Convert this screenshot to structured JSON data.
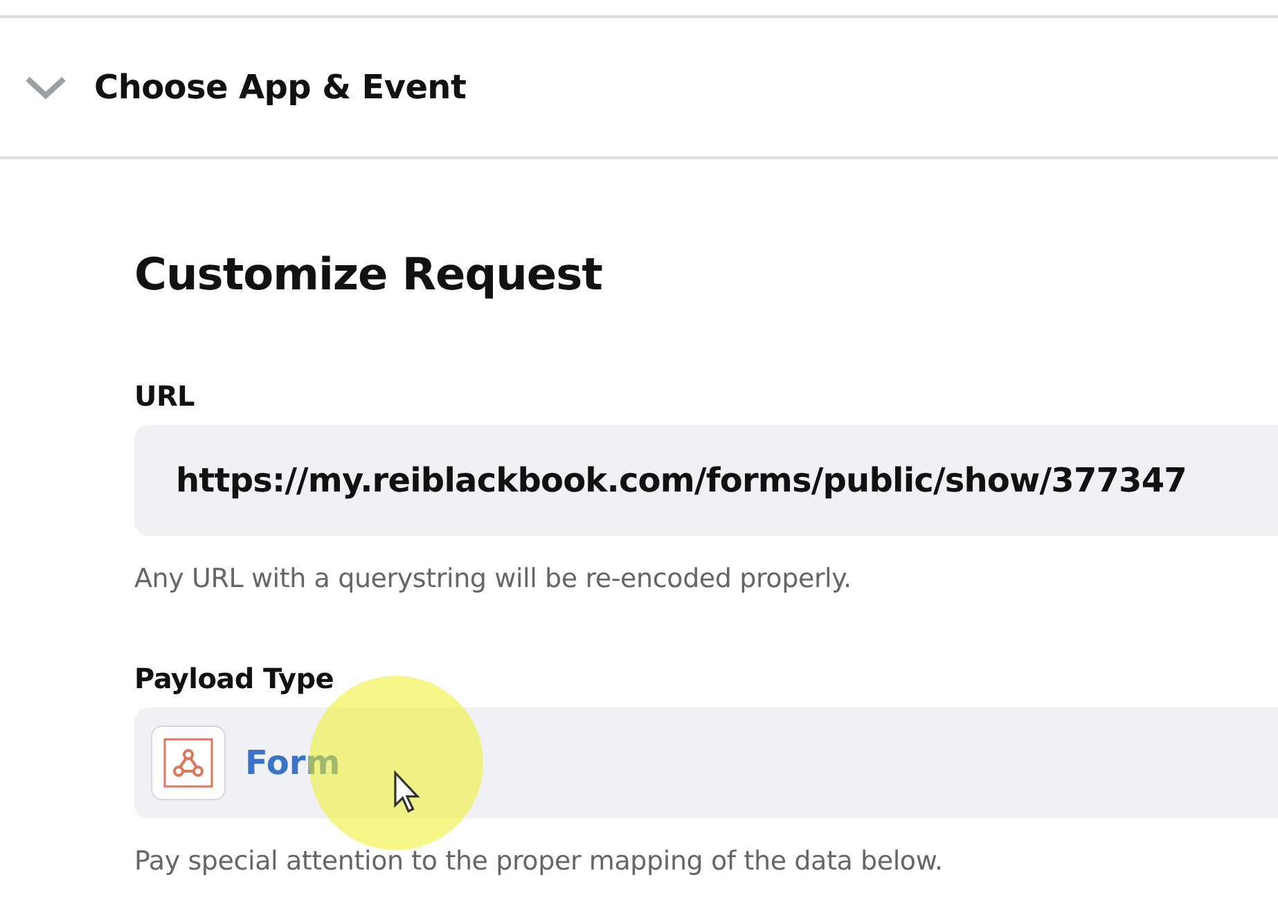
{
  "section": {
    "title": "Choose App & Event",
    "expanded": true
  },
  "form": {
    "title": "Customize Request",
    "fields": [
      {
        "kind": "text",
        "label": "URL",
        "value": "https://my.reiblackbook.com/forms/public/show/377347",
        "hint": "Any URL with a querystring will be re-encoded properly."
      },
      {
        "kind": "select",
        "label": "Payload Type",
        "value": "Form",
        "hint": "Pay special attention to the proper mapping of the data below."
      }
    ]
  }
}
